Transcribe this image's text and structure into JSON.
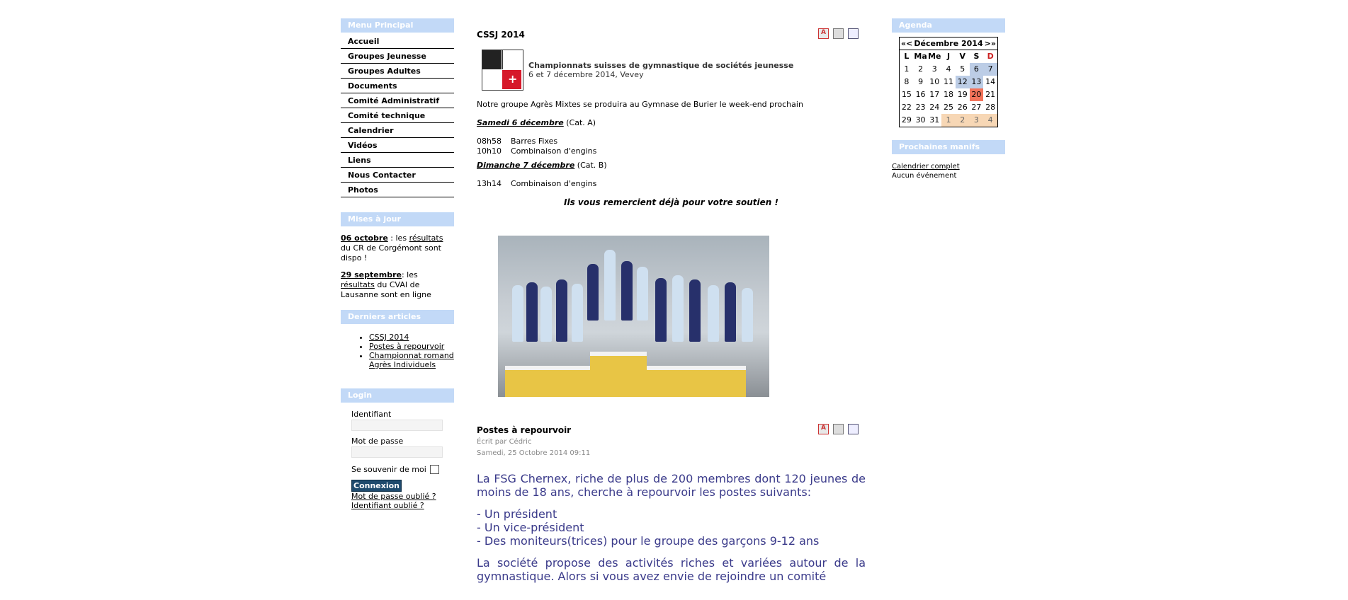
{
  "left": {
    "menu_title": "Menu Principal",
    "menu": [
      "Accueil",
      "Groupes Jeunesse",
      "Groupes Adultes",
      "Documents",
      "Comité Administratif",
      "Comité technique",
      "Calendrier",
      "Vidéos",
      "Liens",
      "Nous Contacter",
      "Photos"
    ],
    "updates_title": "Mises à jour",
    "updates": [
      {
        "date": "06 octobre",
        "pre": " : les ",
        "link": "résultats",
        "post": " du CR de Corgémont sont dispo !"
      },
      {
        "date": "29 septembre",
        "pre": ": les ",
        "link": "résultats",
        "post": " du CVAI de Lausanne sont en ligne"
      }
    ],
    "latest_title": "Derniers articles",
    "latest": [
      "CSSJ 2014",
      "Postes à repourvoir",
      "Championnat romand Agrès Individuels"
    ],
    "login_title": "Login",
    "username_label": "Identifiant",
    "password_label": "Mot de passe",
    "remember_label": "Se souvenir de moi",
    "submit_label": "Connexion",
    "forgot_password": "Mot de passe oublié ?",
    "forgot_username": "Identifiant oublié ?"
  },
  "article1": {
    "title": "CSSJ 2014",
    "banner_title": "Championnats suisses de gymnastique de sociétés jeunesse",
    "banner_sub": "6 et 7 décembre 2014, Vevey",
    "intro": "Notre groupe Agrès Mixtes se produira au Gymnase de Burier le week-end prochain",
    "day1": "Samedi 6 décembre",
    "day1_cat": " (Cat. A)",
    "day1_items": [
      {
        "time": "08h58",
        "label": "Barres Fixes"
      },
      {
        "time": "10h10",
        "label": "Combinaison d'engins"
      }
    ],
    "day2": "Dimanche 7 décembre",
    "day2_cat": " (Cat. B)",
    "day2_items": [
      {
        "time": "13h14",
        "label": "Combinaison d'engins"
      }
    ],
    "thanks": "Ils vous remercient déjà pour votre soutien !"
  },
  "article2": {
    "title": "Postes à repourvoir",
    "author": "Écrit par Cédric",
    "date": "Samedi, 25 Octobre 2014 09:11",
    "p1": "La FSG Chernex, riche de plus de 200 membres dont 120 jeunes de moins de 18 ans, cherche à repourvoir les postes suivants:",
    "items": [
      "- Un président",
      "- Un vice-président",
      "- Des moniteurs(trices) pour le groupe des garçons 9-12 ans"
    ],
    "p2": "La société propose des activités riches et variées autour de la gymnastique. Alors si vous avez envie de rejoindre un comité"
  },
  "right": {
    "agenda_title": "Agenda",
    "cal_prev": "«<",
    "cal_month": "Décembre 2014",
    "cal_next": ">»",
    "days": [
      "L",
      "Ma",
      "Me",
      "J",
      "V",
      "S",
      "D"
    ],
    "weeks": [
      [
        "1",
        "2",
        "3",
        "4",
        "5",
        "6",
        "7"
      ],
      [
        "8",
        "9",
        "10",
        "11",
        "12",
        "13",
        "14"
      ],
      [
        "15",
        "16",
        "17",
        "18",
        "19",
        "20",
        "21"
      ],
      [
        "22",
        "23",
        "24",
        "25",
        "26",
        "27",
        "28"
      ],
      [
        "29",
        "30",
        "31",
        "1",
        "2",
        "3",
        "4"
      ]
    ],
    "next_title": "Prochaines manifs",
    "full_calendar": "Calendrier complet",
    "no_event": "Aucun événement"
  },
  "colors": {
    "box_head": "#c2d9f7",
    "post_text": "#3a3a8a",
    "today": "#f3735a",
    "weekend": "#bccde6"
  }
}
